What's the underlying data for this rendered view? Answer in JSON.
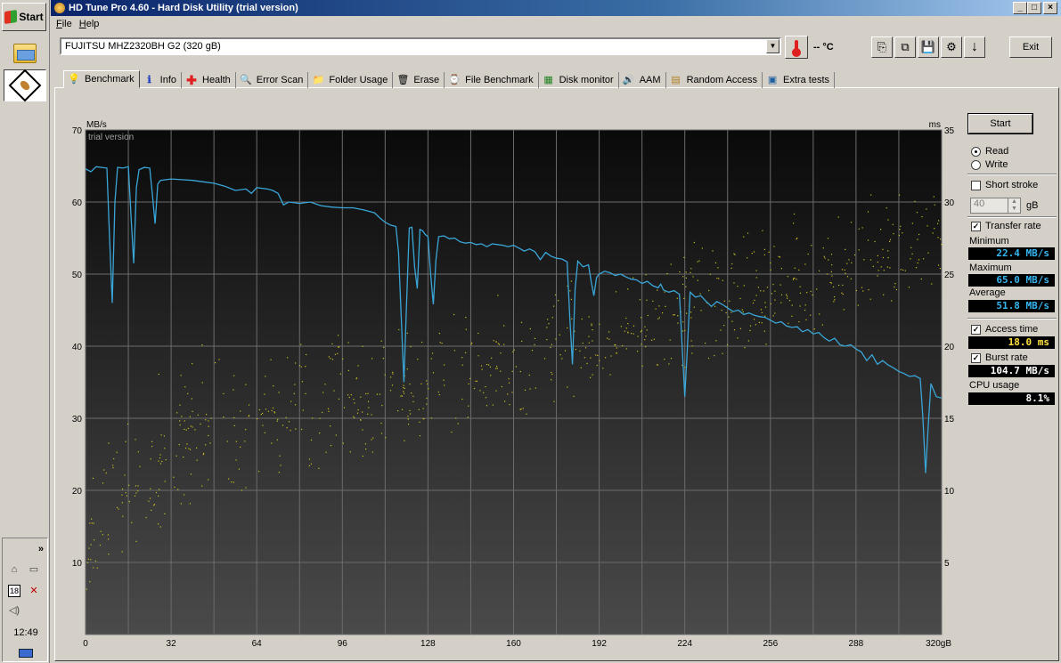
{
  "taskbar": {
    "start_label": "Start",
    "clock": "12:49",
    "tray_date": "18",
    "tray_expand": "»"
  },
  "window": {
    "title": "HD Tune Pro 4.60 - Hard Disk Utility (trial version)",
    "menu": [
      "File",
      "Help"
    ],
    "controls": {
      "minimize": "_",
      "maximize": "□",
      "close": "×"
    }
  },
  "toolbar": {
    "drive": "FUJITSU MHZ2320BH G2 (320 gB)",
    "temperature": "-- °C",
    "exit_label": "Exit"
  },
  "tabs": [
    {
      "label": "Benchmark",
      "icon": "lightbulb-icon",
      "glyph": "💡"
    },
    {
      "label": "Info",
      "icon": "info-icon",
      "glyph": "ℹ"
    },
    {
      "label": "Health",
      "icon": "health-cross-icon",
      "glyph": "✚"
    },
    {
      "label": "Error Scan",
      "icon": "magnifier-icon",
      "glyph": "🔍"
    },
    {
      "label": "Folder Usage",
      "icon": "folder-icon",
      "glyph": "📁"
    },
    {
      "label": "Erase",
      "icon": "trash-icon",
      "glyph": "🗑"
    },
    {
      "label": "File Benchmark",
      "icon": "file-benchmark-icon",
      "glyph": "⌚"
    },
    {
      "label": "Disk monitor",
      "icon": "monitor-chart-icon",
      "glyph": "▦"
    },
    {
      "label": "AAM",
      "icon": "speaker-icon",
      "glyph": "🔊"
    },
    {
      "label": "Random Access",
      "icon": "random-access-icon",
      "glyph": "▤"
    },
    {
      "label": "Extra tests",
      "icon": "extra-tests-icon",
      "glyph": "▣"
    }
  ],
  "benchmark": {
    "start_label": "Start",
    "read_label": "Read",
    "write_label": "Write",
    "mode": "Read",
    "short_stroke_label": "Short stroke",
    "short_stroke_checked": false,
    "short_stroke_value": "40",
    "short_stroke_unit": "gB",
    "transfer_rate_label": "Transfer rate",
    "transfer_rate_checked": true,
    "minimum_label": "Minimum",
    "minimum_value": "22.4 MB/s",
    "maximum_label": "Maximum",
    "maximum_value": "65.0 MB/s",
    "average_label": "Average",
    "average_value": "51.8 MB/s",
    "access_time_label": "Access time",
    "access_time_checked": true,
    "access_time_value": "18.0 ms",
    "burst_rate_label": "Burst rate",
    "burst_rate_checked": true,
    "burst_rate_value": "104.7 MB/s",
    "cpu_usage_label": "CPU usage",
    "cpu_usage_value": "8.1%"
  },
  "chart_data": {
    "type": "line",
    "watermark": "trial version",
    "ylabel_left": "MB/s",
    "ylabel_right": "ms",
    "x_unit_label": "320gB",
    "ylim_left": [
      0,
      70
    ],
    "ylim_right": [
      0,
      35
    ],
    "xlim": [
      0,
      320
    ],
    "x_ticks": [
      "0",
      "32",
      "64",
      "96",
      "128",
      "160",
      "192",
      "224",
      "256",
      "288"
    ],
    "y_ticks_left": [
      "70",
      "60",
      "50",
      "40",
      "30",
      "20",
      "10"
    ],
    "y_ticks_right": [
      "35",
      "30",
      "25",
      "20",
      "15",
      "10",
      "5"
    ],
    "grid": true,
    "colors": {
      "transfer": "#3aa6d8",
      "access": "#c8c020",
      "background_top": "#0a0a0a",
      "background_bottom": "#4a4a4a"
    },
    "series": [
      {
        "name": "Transfer rate",
        "axis": "left",
        "points": [
          [
            0,
            64.6
          ],
          [
            2,
            64.2
          ],
          [
            4,
            64.9
          ],
          [
            6,
            64.8
          ],
          [
            8,
            64.7
          ],
          [
            9,
            55
          ],
          [
            10,
            46
          ],
          [
            11,
            60
          ],
          [
            12,
            64.8
          ],
          [
            14,
            64.7
          ],
          [
            16,
            64.9
          ],
          [
            17,
            58
          ],
          [
            18,
            51.5
          ],
          [
            19,
            62
          ],
          [
            20,
            64.5
          ],
          [
            22,
            64.8
          ],
          [
            24,
            64.7
          ],
          [
            25,
            61
          ],
          [
            26,
            57
          ],
          [
            27,
            62.5
          ],
          [
            28,
            63
          ],
          [
            32,
            63.2
          ],
          [
            36,
            63.1
          ],
          [
            40,
            63
          ],
          [
            44,
            62.8
          ],
          [
            48,
            62.6
          ],
          [
            52,
            62.2
          ],
          [
            56,
            61.6
          ],
          [
            60,
            61.8
          ],
          [
            62,
            61.2
          ],
          [
            64,
            62
          ],
          [
            68,
            61.8
          ],
          [
            70,
            61.6
          ],
          [
            72,
            61.2
          ],
          [
            74,
            59.6
          ],
          [
            76,
            60
          ],
          [
            80,
            59.8
          ],
          [
            84,
            60
          ],
          [
            88,
            59.5
          ],
          [
            92,
            59.3
          ],
          [
            96,
            59.2
          ],
          [
            100,
            59.2
          ],
          [
            104,
            58.9
          ],
          [
            108,
            58.5
          ],
          [
            110,
            57.8
          ],
          [
            112,
            57.2
          ],
          [
            114,
            56.8
          ],
          [
            116,
            56.6
          ],
          [
            117,
            53
          ],
          [
            118,
            44
          ],
          [
            119,
            35
          ],
          [
            120,
            46
          ],
          [
            121,
            56.4
          ],
          [
            122,
            56.5
          ],
          [
            123,
            51
          ],
          [
            124,
            48
          ],
          [
            125,
            56.2
          ],
          [
            126,
            56
          ],
          [
            127,
            55.5
          ],
          [
            128,
            55.2
          ],
          [
            129,
            50
          ],
          [
            130,
            45.8
          ],
          [
            131,
            52
          ],
          [
            132,
            55.2
          ],
          [
            134,
            55.3
          ],
          [
            136,
            54.9
          ],
          [
            138,
            55
          ],
          [
            140,
            54.5
          ],
          [
            142,
            54.3
          ],
          [
            144,
            54.4
          ],
          [
            146,
            54.1
          ],
          [
            148,
            54.2
          ],
          [
            150,
            53.8
          ],
          [
            152,
            54.2
          ],
          [
            154,
            54.1
          ],
          [
            156,
            54
          ],
          [
            158,
            53.8
          ],
          [
            160,
            54
          ],
          [
            162,
            53.6
          ],
          [
            164,
            53.2
          ],
          [
            166,
            53.5
          ],
          [
            168,
            53.1
          ],
          [
            170,
            52
          ],
          [
            172,
            53
          ],
          [
            174,
            52.5
          ],
          [
            176,
            52.2
          ],
          [
            178,
            52.1
          ],
          [
            180,
            51.7
          ],
          [
            181,
            44
          ],
          [
            182,
            37.5
          ],
          [
            183,
            48
          ],
          [
            184,
            51.8
          ],
          [
            186,
            51
          ],
          [
            188,
            51.3
          ],
          [
            189,
            49
          ],
          [
            190,
            47
          ],
          [
            191,
            49.5
          ],
          [
            192,
            50
          ],
          [
            194,
            50.4
          ],
          [
            196,
            50.2
          ],
          [
            198,
            49.8
          ],
          [
            200,
            50
          ],
          [
            202,
            49.6
          ],
          [
            204,
            49.3
          ],
          [
            206,
            49.2
          ],
          [
            208,
            48.7
          ],
          [
            210,
            49
          ],
          [
            212,
            48.4
          ],
          [
            214,
            48.1
          ],
          [
            215,
            48.6
          ],
          [
            216,
            47.8
          ],
          [
            218,
            47.5
          ],
          [
            220,
            47.7
          ],
          [
            222,
            47.2
          ],
          [
            223,
            40
          ],
          [
            224,
            33
          ],
          [
            225,
            40
          ],
          [
            226,
            47.5
          ],
          [
            228,
            46.8
          ],
          [
            230,
            47
          ],
          [
            232,
            46.2
          ],
          [
            234,
            45.5
          ],
          [
            236,
            46.2
          ],
          [
            238,
            45.8
          ],
          [
            240,
            45.3
          ],
          [
            242,
            44.8
          ],
          [
            244,
            45
          ],
          [
            246,
            44.4
          ],
          [
            248,
            44.6
          ],
          [
            250,
            44.3
          ],
          [
            252,
            44.1
          ],
          [
            254,
            44
          ],
          [
            256,
            43.6
          ],
          [
            258,
            43.2
          ],
          [
            260,
            43.4
          ],
          [
            262,
            42.8
          ],
          [
            264,
            42.6
          ],
          [
            266,
            42.7
          ],
          [
            268,
            42
          ],
          [
            270,
            42.3
          ],
          [
            272,
            41.7
          ],
          [
            274,
            41.9
          ],
          [
            276,
            41.2
          ],
          [
            278,
            40.7
          ],
          [
            280,
            41.1
          ],
          [
            282,
            40.2
          ],
          [
            284,
            40
          ],
          [
            286,
            40.2
          ],
          [
            288,
            39.6
          ],
          [
            290,
            39.2
          ],
          [
            292,
            38
          ],
          [
            294,
            38.8
          ],
          [
            296,
            37.5
          ],
          [
            298,
            38
          ],
          [
            300,
            37.4
          ],
          [
            302,
            37
          ],
          [
            304,
            36.5
          ],
          [
            306,
            36.2
          ],
          [
            308,
            35.8
          ],
          [
            310,
            35.9
          ],
          [
            312,
            35.5
          ],
          [
            313,
            30
          ],
          [
            314,
            22.4
          ],
          [
            315,
            29
          ],
          [
            316,
            34.8
          ],
          [
            318,
            33
          ],
          [
            320,
            32.8
          ]
        ]
      },
      {
        "name": "Access time",
        "axis": "right",
        "style": "scatter",
        "range_x": [
          0,
          320
        ],
        "lower_ms": [
          [
            0,
            3
          ],
          [
            40,
            9
          ],
          [
            100,
            12
          ],
          [
            160,
            15
          ],
          [
            220,
            18
          ],
          [
            320,
            24
          ]
        ],
        "upper_ms": [
          [
            0,
            13
          ],
          [
            30,
            20
          ],
          [
            90,
            22
          ],
          [
            160,
            24
          ],
          [
            220,
            28
          ],
          [
            320,
            32
          ]
        ],
        "count": 800
      }
    ]
  }
}
